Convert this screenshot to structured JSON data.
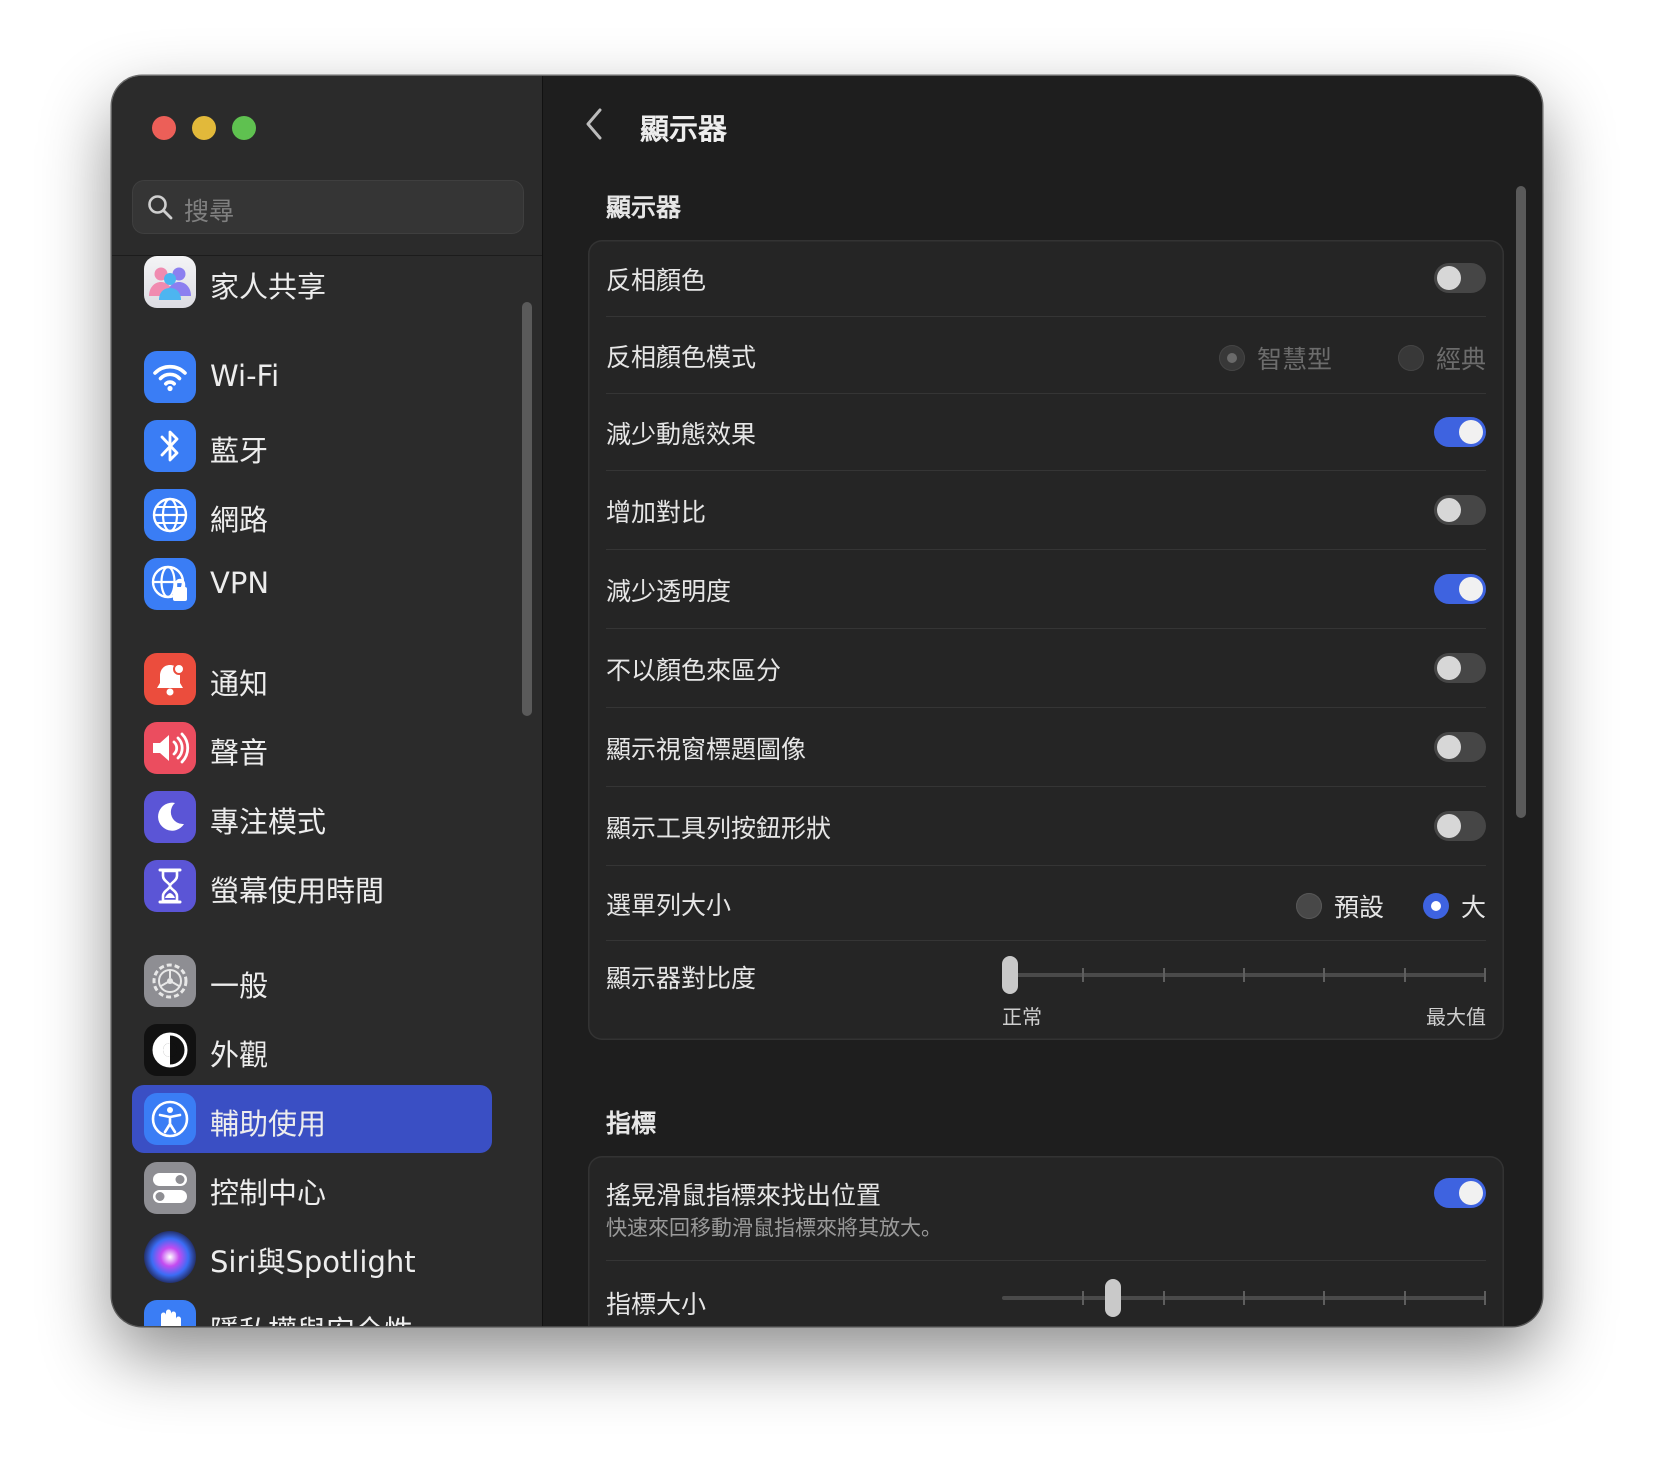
{
  "window": {
    "title": "顯示器"
  },
  "search": {
    "placeholder": "搜尋"
  },
  "sidebar": {
    "items": [
      {
        "label": "家人共享",
        "icon": "family-icon"
      },
      {
        "label": "Wi-Fi",
        "icon": "wifi-icon"
      },
      {
        "label": "藍牙",
        "icon": "bluetooth-icon"
      },
      {
        "label": "網路",
        "icon": "globe-icon"
      },
      {
        "label": "VPN",
        "icon": "vpn-icon"
      },
      {
        "label": "通知",
        "icon": "bell-icon"
      },
      {
        "label": "聲音",
        "icon": "speaker-icon"
      },
      {
        "label": "專注模式",
        "icon": "moon-icon"
      },
      {
        "label": "螢幕使用時間",
        "icon": "hourglass-icon"
      },
      {
        "label": "一般",
        "icon": "gear-icon"
      },
      {
        "label": "外觀",
        "icon": "appearance-icon"
      },
      {
        "label": "輔助使用",
        "icon": "accessibility-icon",
        "selected": true
      },
      {
        "label": "控制中心",
        "icon": "control-center-icon"
      },
      {
        "label": "Siri與Spotlight",
        "icon": "siri-icon"
      },
      {
        "label": "隱私權與安全性",
        "icon": "hand-icon"
      }
    ]
  },
  "display": {
    "section_title": "顯示器",
    "invert_colors": {
      "label": "反相顏色",
      "on": false
    },
    "invert_mode": {
      "label": "反相顏色模式",
      "options": [
        "智慧型",
        "經典"
      ],
      "selected": "智慧型",
      "enabled": false
    },
    "reduce_motion": {
      "label": "減少動態效果",
      "on": true
    },
    "increase_contrast": {
      "label": "增加對比",
      "on": false
    },
    "reduce_transparency": {
      "label": "減少透明度",
      "on": true
    },
    "differentiate_without_color": {
      "label": "不以顏色來區分",
      "on": false
    },
    "show_window_title_icons": {
      "label": "顯示視窗標題圖像",
      "on": false
    },
    "show_toolbar_button_shapes": {
      "label": "顯示工具列按鈕形狀",
      "on": false
    },
    "menu_bar_size": {
      "label": "選單列大小",
      "options": [
        "預設",
        "大"
      ],
      "selected": "大"
    },
    "display_contrast": {
      "label": "顯示器對比度",
      "min_label": "正常",
      "max_label": "最大值",
      "value": 0,
      "steps": 7
    }
  },
  "pointer": {
    "section_title": "指標",
    "shake_to_locate": {
      "label": "搖晃滑鼠指標來找出位置",
      "description": "快速來回移動滑鼠指標來將其放大。",
      "on": true
    },
    "pointer_size": {
      "label": "指標大小",
      "value": 0.22,
      "steps": 7
    }
  },
  "colors": {
    "accent": "#3e63e0",
    "sidebar_selected": "#3a4fc4",
    "window_bg": "#1e1e1e",
    "sidebar_bg": "#2b2b2b"
  }
}
